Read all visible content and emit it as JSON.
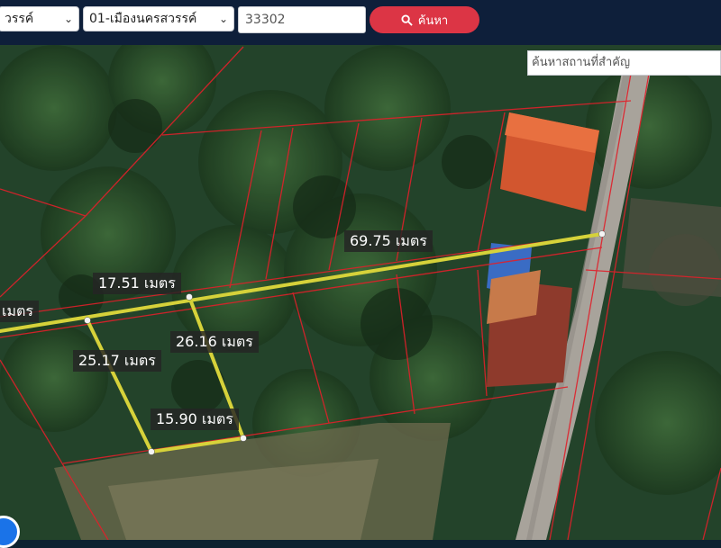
{
  "toolbar": {
    "province_select": "วรรค์",
    "district_select": "01-เมืองนครสวรรค์",
    "parcel_input": "33302",
    "search_button": "ค้นหา"
  },
  "place_search_placeholder": "ค้นหาสถานที่สำคัญ",
  "measurements": [
    {
      "id": "m1",
      "text": "69.75 เมตร"
    },
    {
      "id": "m2",
      "text": "17.51 เมตร"
    },
    {
      "id": "m3",
      "text": "เมตร"
    },
    {
      "id": "m4",
      "text": "26.16 เมตร"
    },
    {
      "id": "m5",
      "text": "25.17 เมตร"
    },
    {
      "id": "m6",
      "text": "15.90 เมตร"
    }
  ],
  "colors": {
    "topbar": "#0e1f3a",
    "accent": "#dc3545",
    "parcel_line": "#e0202a",
    "measure_line": "#d6d23a"
  },
  "icons": {
    "search": "magnifier-icon",
    "location": "location-icon"
  }
}
